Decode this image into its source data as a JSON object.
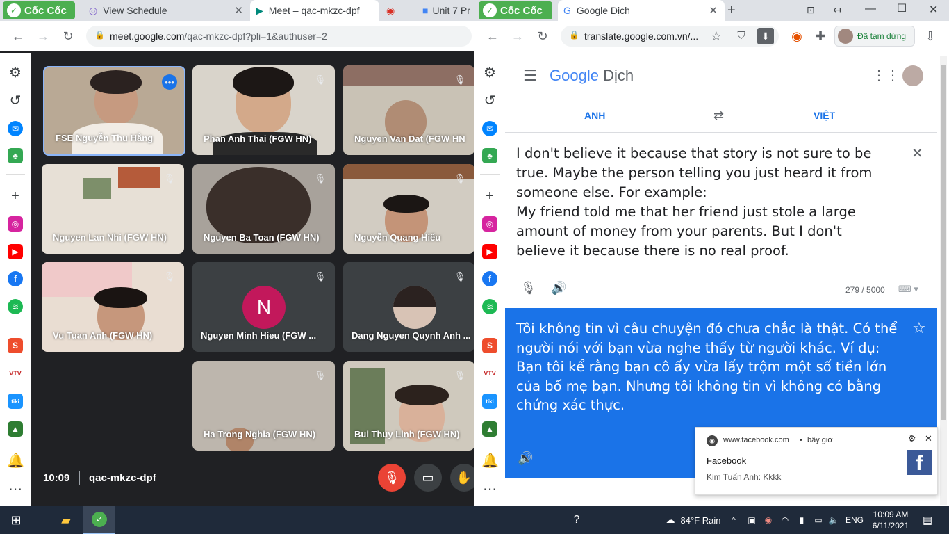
{
  "left_browser": {
    "tabs": [
      {
        "label": "Cốc Cốc"
      },
      {
        "label": "View Schedule"
      },
      {
        "label": "Meet – qac-mkzc-dpf"
      },
      {
        "label": "Unit 7 Pr"
      }
    ],
    "url_host": "meet.google.com",
    "url_path": "/qac-mkzc-dpf?pli=1&authuser=2"
  },
  "meet": {
    "participants": [
      {
        "name": "FSE Nguyễn Thu Hằng"
      },
      {
        "name": "Phan Anh Thai (FGW HN)"
      },
      {
        "name": "Nguyen Van Dat (FGW HN"
      },
      {
        "name": "Nguyen Lan Nhi (FGW HN)"
      },
      {
        "name": "Nguyen Ba Toan (FGW HN)"
      },
      {
        "name": "Nguyễn Quang Hiếu"
      },
      {
        "name": "Vu Tuan Anh (FGW HN)"
      },
      {
        "name": "Nguyen Minh Hieu (FGW ..."
      },
      {
        "name": "Dang Nguyen Quynh Anh ..."
      },
      {
        "name": "Ha Trong Nghia (FGW HN)"
      },
      {
        "name": "Bui Thuy Linh (FGW HN)"
      }
    ],
    "avatar_letter": "N",
    "time": "10:09",
    "meeting_code": "qac-mkzc-dpf"
  },
  "right_browser": {
    "tabs": [
      {
        "label": "Cốc Cốc"
      },
      {
        "label": "Google Dịch"
      }
    ],
    "url": "translate.google.com.vn/...",
    "paused_label": "Đã tạm dừng"
  },
  "translate": {
    "logo_google": "Google",
    "logo_product": "Dịch",
    "source_lang": "ANH",
    "target_lang": "VIỆT",
    "source_text": "I don't believe it because that story is not sure to be true. Maybe the person telling you just heard it from someone else. For example:\nMy friend told me that her friend just stole a large amount of money from your parents. But I don't believe it because there is no real proof.",
    "char_count": "279 / 5000",
    "translated_text": "Tôi không tin vì câu chuyện đó chưa chắc là thật. Có thể người nói với bạn vừa nghe thấy từ người khác. Ví dụ:\nBạn tôi kể rằng bạn cô ấy vừa lấy trộm một số tiền lớn của bố mẹ bạn. Nhưng tôi không tin vì không có bằng chứng xác thực."
  },
  "notification": {
    "source": "www.facebook.com",
    "time": "bây giờ",
    "title": "Facebook",
    "message": "Kim Tuấn Anh: Kkkk"
  },
  "taskbar": {
    "weather": "84°F  Rain",
    "language": "ENG",
    "clock_time": "10:09 AM",
    "clock_date": "6/11/2021"
  },
  "colors": {
    "meet_bg": "#202124",
    "translate_blue": "#1a73e8",
    "coccoc_green": "#4caf50",
    "end_call_red": "#ea4335"
  }
}
